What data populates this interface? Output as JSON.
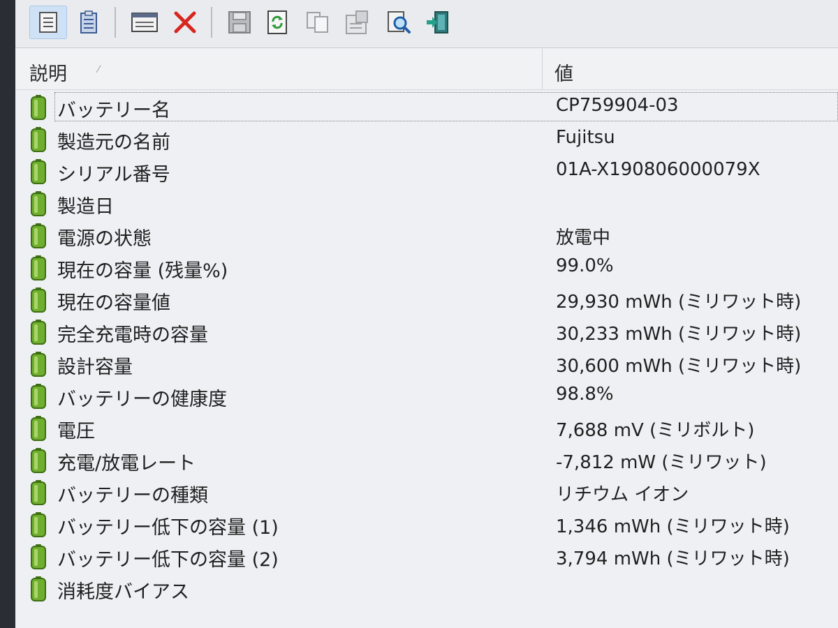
{
  "toolbar": {
    "buttons": [
      {
        "icon": "report-view-icon",
        "active": true
      },
      {
        "icon": "clipboard-icon",
        "active": false
      },
      {
        "icon": "properties-window-icon",
        "active": false
      },
      {
        "icon": "delete-x-icon",
        "active": false
      },
      {
        "icon": "save-icon",
        "active": false
      },
      {
        "icon": "refresh-icon",
        "active": false
      },
      {
        "icon": "copy-icon",
        "active": false
      },
      {
        "icon": "html-report-icon",
        "active": false
      },
      {
        "icon": "find-icon",
        "active": false
      },
      {
        "icon": "exit-icon",
        "active": false
      }
    ]
  },
  "header": {
    "desc_label": "説明",
    "value_label": "値"
  },
  "rows": [
    {
      "label": "バッテリー名",
      "value": "CP759904-03"
    },
    {
      "label": "製造元の名前",
      "value": "Fujitsu"
    },
    {
      "label": "シリアル番号",
      "value": "01A-X190806000079X"
    },
    {
      "label": "製造日",
      "value": ""
    },
    {
      "label": "電源の状態",
      "value": "放電中"
    },
    {
      "label": "現在の容量 (残量%)",
      "value": "99.0%"
    },
    {
      "label": "現在の容量値",
      "value": "29,930 mWh (ミリワット時)"
    },
    {
      "label": "完全充電時の容量",
      "value": "30,233 mWh (ミリワット時)"
    },
    {
      "label": "設計容量",
      "value": "30,600 mWh (ミリワット時)"
    },
    {
      "label": "バッテリーの健康度",
      "value": "98.8%"
    },
    {
      "label": "電圧",
      "value": "7,688 mV (ミリボルト)"
    },
    {
      "label": "充電/放電レート",
      "value": "-7,812 mW (ミリワット)"
    },
    {
      "label": "バッテリーの種類",
      "value": "リチウム イオン"
    },
    {
      "label": "バッテリー低下の容量 (1)",
      "value": "1,346 mWh (ミリワット時)"
    },
    {
      "label": "バッテリー低下の容量 (2)",
      "value": "3,794 mWh (ミリワット時)"
    },
    {
      "label": "消耗度バイアス",
      "value": ""
    }
  ],
  "colors": {
    "battery_green": "#6fae2e",
    "battery_dark": "#3d6e14",
    "delete_red": "#d8261f"
  }
}
